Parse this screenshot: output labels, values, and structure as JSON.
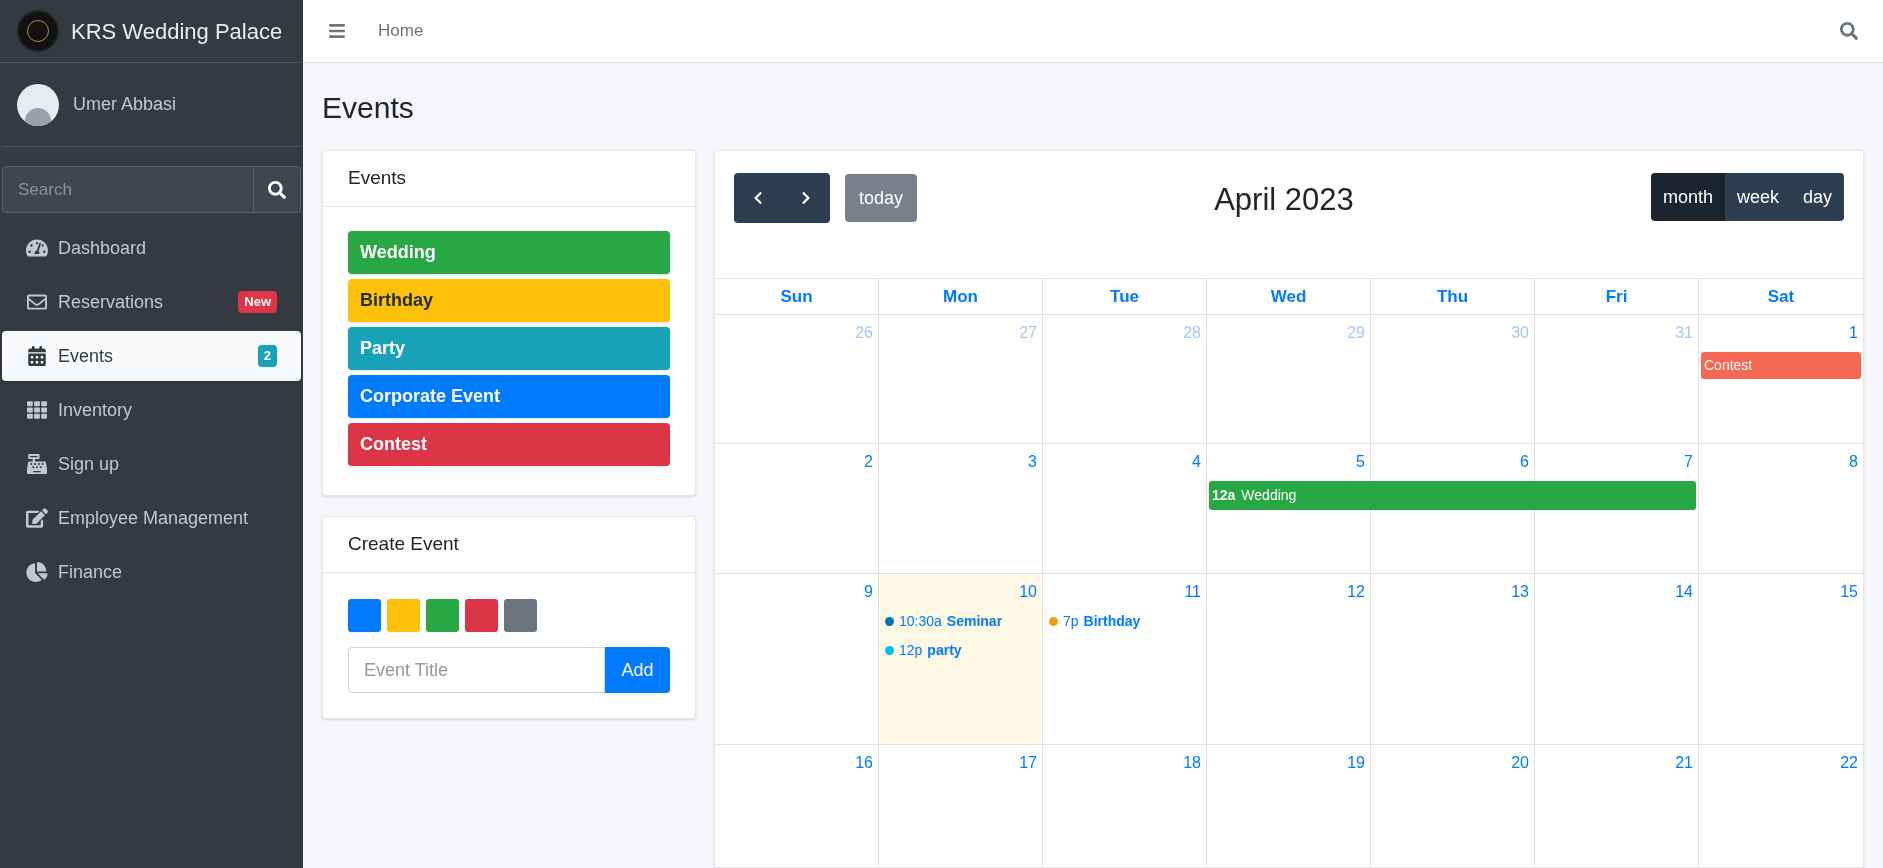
{
  "brand": {
    "title": "KRS Wedding Palace"
  },
  "user": {
    "name": "Umer Abbasi"
  },
  "sidebar_search": {
    "placeholder": "Search"
  },
  "nav": [
    {
      "label": "Dashboard",
      "selected": false
    },
    {
      "label": "Reservations",
      "selected": false,
      "badge": {
        "text": "New",
        "color": "#dc3545"
      }
    },
    {
      "label": "Events",
      "selected": true,
      "badge": {
        "text": "2",
        "color": "#17a2b8"
      }
    },
    {
      "label": "Inventory",
      "selected": false
    },
    {
      "label": "Sign up",
      "selected": false
    },
    {
      "label": "Employee Management",
      "selected": false
    },
    {
      "label": "Finance",
      "selected": false
    }
  ],
  "topbar": {
    "breadcrumb": "Home"
  },
  "page_title": "Events",
  "events_card": {
    "title": "Events",
    "items": [
      {
        "label": "Wedding",
        "color": "#28a745"
      },
      {
        "label": "Birthday",
        "color": "#ffc107"
      },
      {
        "label": "Party",
        "color": "#17a2b8"
      },
      {
        "label": "Corporate Event",
        "color": "#007bff"
      },
      {
        "label": "Contest",
        "color": "#dc3545"
      }
    ]
  },
  "create_card": {
    "title": "Create Event",
    "swatches": [
      {
        "color": "#007bff"
      },
      {
        "color": "#ffc107"
      },
      {
        "color": "#28a745"
      },
      {
        "color": "#dc3545"
      },
      {
        "color": "#6c757d"
      }
    ],
    "placeholder": "Event Title",
    "button": "Add"
  },
  "calendar": {
    "title": "April 2023",
    "today_button": "today",
    "views": [
      {
        "label": "month",
        "selected": true
      },
      {
        "label": "week",
        "selected": false
      },
      {
        "label": "day",
        "selected": false
      }
    ],
    "weekdays": [
      "Sun",
      "Mon",
      "Tue",
      "Wed",
      "Thu",
      "Fri",
      "Sat"
    ],
    "weeks": [
      {
        "days": [
          {
            "number": "26",
            "other_month": true
          },
          {
            "number": "27",
            "other_month": true
          },
          {
            "number": "28",
            "other_month": true
          },
          {
            "number": "29",
            "other_month": true
          },
          {
            "number": "30",
            "other_month": true
          },
          {
            "number": "31",
            "other_month": true
          },
          {
            "number": "1",
            "other_month": false,
            "events": [
              {
                "kind": "block",
                "title": "Contest",
                "color": "#f56954"
              }
            ]
          }
        ]
      },
      {
        "days": [
          {
            "number": "2",
            "other_month": false
          },
          {
            "number": "3",
            "other_month": false
          },
          {
            "number": "4",
            "other_month": false
          },
          {
            "number": "5",
            "other_month": false,
            "events": [
              {
                "kind": "bar",
                "time": "12a",
                "title": "Wedding",
                "color": "#28a745"
              }
            ]
          },
          {
            "number": "6",
            "other_month": false,
            "continued": true
          },
          {
            "number": "7",
            "other_month": false,
            "continued": true
          },
          {
            "number": "8",
            "other_month": false
          }
        ]
      },
      {
        "days": [
          {
            "number": "9",
            "other_month": false
          },
          {
            "number": "10",
            "other_month": false,
            "today": true,
            "events": [
              {
                "kind": "dot",
                "time": "10:30a",
                "title": "Seminar",
                "color": "#0073b7"
              },
              {
                "kind": "dot",
                "time": "12p",
                "title": "party",
                "color": "#00c0ef"
              }
            ]
          },
          {
            "number": "11",
            "other_month": false,
            "events": [
              {
                "kind": "dot",
                "time": "7p",
                "title": "Birthday",
                "color": "#f39c12"
              }
            ]
          },
          {
            "number": "12",
            "other_month": false
          },
          {
            "number": "13",
            "other_month": false
          },
          {
            "number": "14",
            "other_month": false
          },
          {
            "number": "15",
            "other_month": false
          }
        ]
      },
      {
        "days": [
          {
            "number": "16",
            "other_month": false
          },
          {
            "number": "17",
            "other_month": false
          },
          {
            "number": "18",
            "other_month": false
          },
          {
            "number": "19",
            "other_month": false
          },
          {
            "number": "20",
            "other_month": false
          },
          {
            "number": "21",
            "other_month": false
          },
          {
            "number": "22",
            "other_month": false
          }
        ]
      }
    ]
  }
}
